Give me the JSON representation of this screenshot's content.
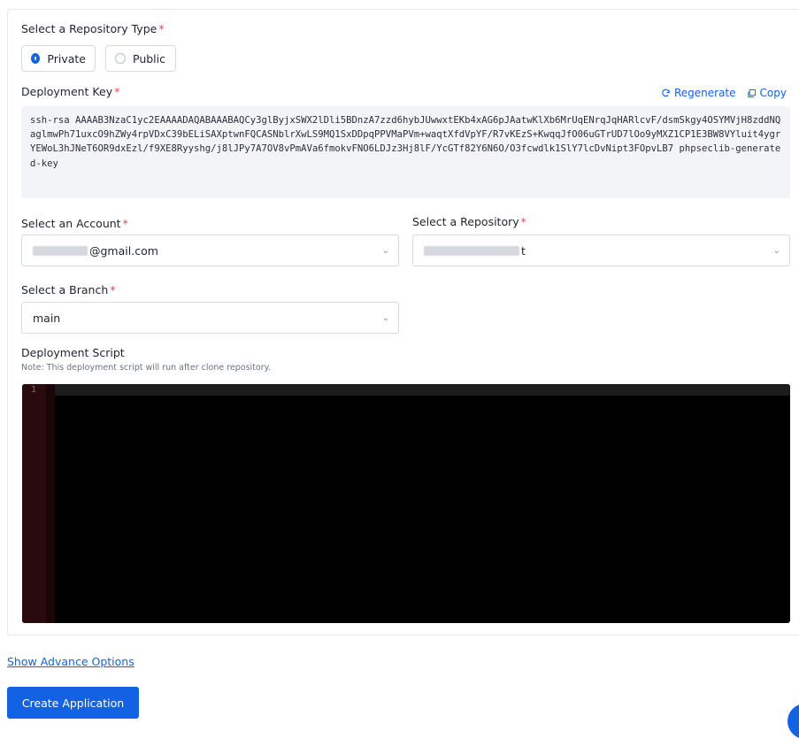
{
  "repo_type": {
    "label": "Select a Repository Type",
    "required": "*",
    "options": [
      {
        "label": "Private",
        "selected": true
      },
      {
        "label": "Public",
        "selected": false
      }
    ]
  },
  "deployment_key": {
    "label": "Deployment Key",
    "required": "*",
    "regenerate_label": "Regenerate",
    "copy_label": "Copy",
    "value": "ssh-rsa AAAAB3NzaC1yc2EAAAADAQABAAABAQCy3glByjxSWX2lDli5BDnzA7zzd6hybJUwwxtEKb4xAG6pJAatwKlXb6MrUqENrqJqHARlcvF/dsmSkgy4OSYMVjH8zddNQaglmwPh71uxcO9hZWy4rpVDxC39bELiSAXptwnFQCASNblrXwLS9MQ1SxDDpqPPVMaPVm+waqtXfdVpYF/R7vKEzS+KwqqJfO06uGTrUD7lOo9yMXZ1CP1E3BW8VYluit4ygrYEWoL3hJNeT6OR9dxEzl/f9XE8Ryyshg/j8lJPy7A7OV8vPmAVa6fmokvFNO6LDJz3Hj8lF/YcGTf82Y6N6O/O3fcwdlk1SlY7lcDvNipt3FOpvLB7 phpseclib-generated-key"
  },
  "account": {
    "label": "Select an Account",
    "required": "*",
    "value_suffix": "@gmail.com"
  },
  "repository": {
    "label": "Select a Repository",
    "required": "*",
    "value_suffix": "t"
  },
  "branch": {
    "label": "Select a Branch",
    "required": "*",
    "value": "main"
  },
  "script": {
    "label": "Deployment Script",
    "note": "Note: This deployment script will run after clone repository.",
    "line_number": "1"
  },
  "advance_link": "Show Advance Options",
  "create_button": "Create Application",
  "colors": {
    "accent": "#1262e3",
    "required": "#e5484d",
    "editor_bg": "#000000"
  },
  "icons": {
    "regenerate": "refresh-icon",
    "copy": "copy-icon",
    "chevron": "chevron-down-icon"
  }
}
